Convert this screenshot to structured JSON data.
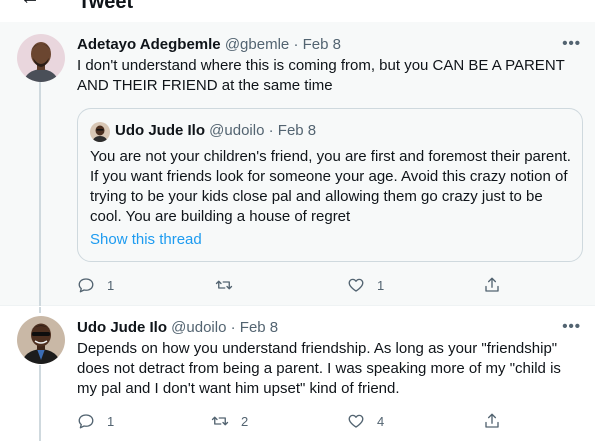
{
  "page": {
    "title": "Tweet"
  },
  "tweets": [
    {
      "name": "Adetayo Adegbemle",
      "handle": "@gbemle",
      "separator": "·",
      "date": "Feb 8",
      "more": "•••",
      "text": "I don't understand where this is coming from, but you CAN BE A PARENT AND THEIR FRIEND at the same time",
      "quote": {
        "name": "Udo Jude Ilo",
        "handle": "@udoilo",
        "separator": "·",
        "date": "Feb 8",
        "text": "You are not your children's friend, you are first and foremost their parent. If you want friends look for someone your age. Avoid this crazy notion of trying to be your kids close pal and allowing them go crazy just to be cool. You are building a house of regret",
        "link": "Show this thread"
      },
      "actions": {
        "reply_count": "1",
        "retweet_count": "",
        "like_count": "1"
      }
    },
    {
      "name": "Udo Jude Ilo",
      "handle": "@udoilo",
      "separator": "·",
      "date": "Feb 8",
      "more": "•••",
      "text": "Depends on how you understand friendship. As long as your \"friendship\" does not detract from being a parent. I was speaking more of my \"child is my pal and I don't want him upset\" kind of friend.",
      "actions": {
        "reply_count": "1",
        "retweet_count": "2",
        "like_count": "4"
      }
    }
  ],
  "colors": {
    "accent": "#1d9bf0",
    "text": "#0f1419",
    "muted": "#536471",
    "highlight_bg": "#f7f9f9",
    "border": "#cfd9de"
  },
  "icons": [
    "back-arrow-icon",
    "more-icon",
    "reply-icon",
    "retweet-icon",
    "like-icon",
    "share-icon"
  ]
}
